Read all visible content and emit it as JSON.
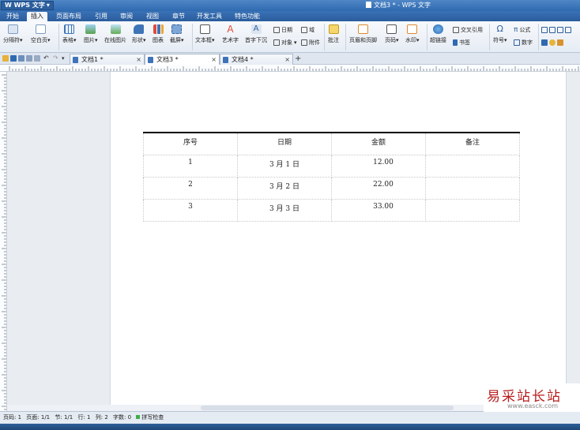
{
  "app": {
    "logo_label": "W WPS 文字",
    "window_title": "文档3 * - WPS 文字"
  },
  "menu": {
    "tabs": [
      "开始",
      "插入",
      "页面布局",
      "引用",
      "审阅",
      "视图",
      "章节",
      "开发工具",
      "特色功能"
    ],
    "active": "插入"
  },
  "ribbon": {
    "separator_label": "分隔符",
    "blank_page_label": "空白页",
    "table_label": "表格",
    "picture_label": "图片",
    "online_picture_label": "在线图片",
    "shape_label": "形状",
    "chart_label": "图表",
    "screenshot_label": "截屏",
    "textbox_label": "文本框",
    "wordart_label": "艺术字",
    "dropcap_label": "首字下沉",
    "date_label": "日期",
    "field_label": "域",
    "object_label": "对象",
    "attachment_label": "附件",
    "comment_label": "批注",
    "header_footer_label": "页眉和页脚",
    "page_number_label": "页码",
    "watermark_label": "水印",
    "hyperlink_label": "超链接",
    "crossref_label": "交叉引用",
    "bookmark_label": "书签",
    "symbol_label": "符号",
    "formula_label": "公式",
    "number_label": "数字"
  },
  "doc_tabs": [
    {
      "label": "文档1 *",
      "active": false
    },
    {
      "label": "文档3 *",
      "active": true
    },
    {
      "label": "文档4 *",
      "active": false
    }
  ],
  "table": {
    "headers": [
      "序号",
      "日期",
      "金额",
      "备注"
    ],
    "rows": [
      [
        "1",
        "3 月 1 日",
        "12.00",
        ""
      ],
      [
        "2",
        "3 月 2 日",
        "22.00",
        ""
      ],
      [
        "3",
        "3 月 3 日",
        "33.00",
        ""
      ]
    ]
  },
  "status": {
    "page_no": "页码: 1",
    "pages": "页面: 1/1",
    "section": "节: 1/1",
    "line": "行: 1",
    "column": "列: 2",
    "word_count": "字数: 0",
    "spell_check": "拼写检查"
  },
  "watermark": {
    "text": "易采站长站",
    "url": "www.easck.com"
  },
  "colors": {
    "title_bar": "#3a72b6",
    "ribbon_bg": "#eef2f8",
    "canvas_bg": "#e9edf2",
    "watermark_text": "#b71d1d"
  }
}
